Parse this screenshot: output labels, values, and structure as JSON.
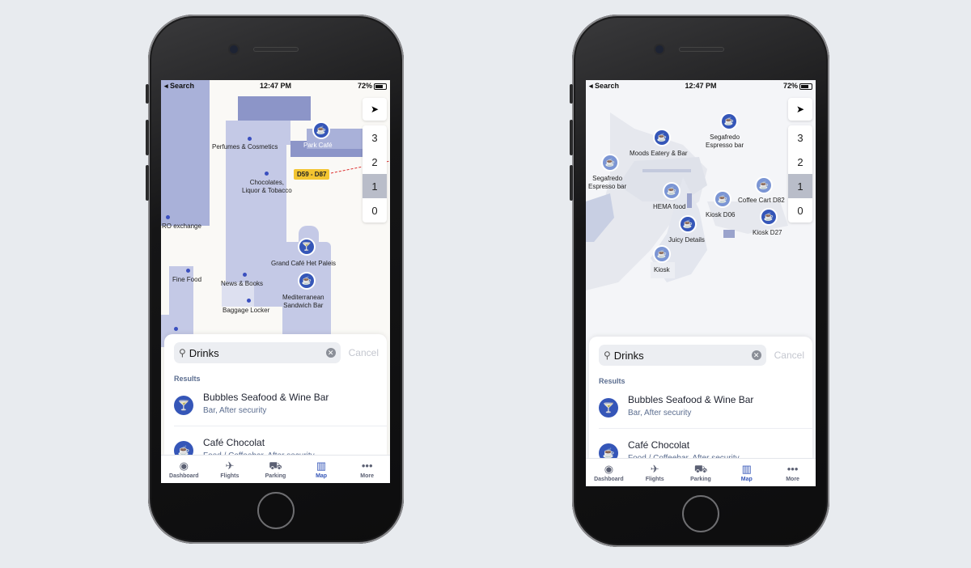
{
  "status": {
    "left": "◂ Search",
    "time": "12:47 PM",
    "battery": "72%"
  },
  "floors": [
    "3",
    "2",
    "1",
    "0"
  ],
  "active_floor": "1",
  "search": {
    "query": "Drinks",
    "cancel_label": "Cancel",
    "results_header": "Results"
  },
  "results": [
    {
      "title": "Bubbles Seafood & Wine Bar",
      "subtitle": "Bar, After security",
      "icon": "cocktail-icon"
    },
    {
      "title": "Café Chocolat",
      "subtitle": "Food / Coffeebar, After security",
      "icon": "coffee-cup-icon"
    }
  ],
  "tabs": [
    {
      "label": "Dashboard",
      "icon": "dashboard-icon"
    },
    {
      "label": "Flights",
      "icon": "plane-icon"
    },
    {
      "label": "Parking",
      "icon": "car-icon"
    },
    {
      "label": "Map",
      "icon": "map-icon",
      "active": true
    },
    {
      "label": "More",
      "icon": "more-dots-icon"
    }
  ],
  "map_left": {
    "labels": {
      "perfumes": "Perfumes & Cosmetics",
      "park_cafe": "Park Café",
      "gate": "D59 - D87",
      "chocolates": "Chocolates,\nLiquor & Tobacco",
      "exchange": "RO exchange",
      "grand_cafe": "Grand Café Het Paleis",
      "fine_food": "Fine Food",
      "news": "News & Books",
      "mediterranean": "Mediterranean\nSandwich Bar",
      "baggage": "Baggage Locker"
    }
  },
  "map_right": {
    "labels": {
      "segafredo_top": "Segafredo\nEspresso bar",
      "moods": "Moods Eatery & Bar",
      "segafredo_left": "Segafredo\nEspresso bar",
      "coffee_cart": "Coffee Cart D82",
      "hema": "HEMA food",
      "kiosk_d06": "Kiosk D06",
      "kiosk_d27": "Kiosk D27",
      "juicy": "Juicy Details",
      "kiosk": "Kiosk"
    }
  },
  "colors": {
    "accent": "#3556b8",
    "gate_tag": "#f3c531",
    "building": "#a9b1d9"
  }
}
